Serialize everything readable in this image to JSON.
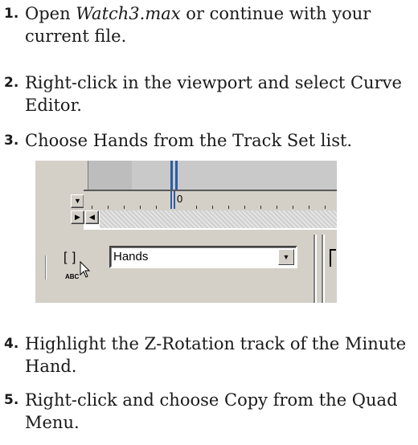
{
  "steps": [
    {
      "num": "1.",
      "pre": "Open ",
      "em": "Watch3.max",
      "post": " or continue with your current file."
    },
    {
      "num": "2.",
      "text": "Right-click in the viewport and select Curve Editor."
    },
    {
      "num": "3.",
      "text": "Choose Hands from the Track Set list."
    },
    {
      "num": "4.",
      "text": "Highlight the Z-Rotation track of the Minute Hand."
    },
    {
      "num": "5.",
      "text": "Right-click and choose Copy from the Quad Menu."
    }
  ],
  "screenshot": {
    "ruler_zero": "0",
    "brackets": "[ ]",
    "abc_label": "ABC",
    "trackset_value": "Hands",
    "scroll_down_glyph": "▼",
    "scroll_right_glyph": "▶",
    "scroll_left_glyph": "◀",
    "drop_glyph": "▼"
  },
  "colors": {
    "highlight_blue": "#2b5ea8",
    "ui_gray": "#d4d0c8"
  }
}
